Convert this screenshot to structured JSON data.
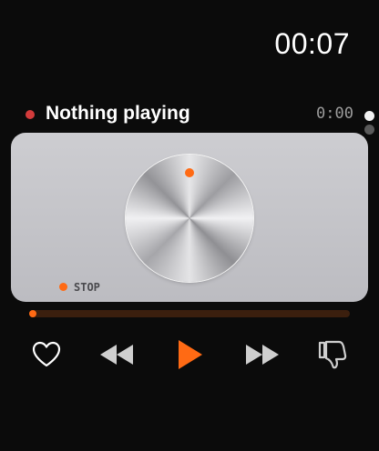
{
  "status": {
    "time": "00:07"
  },
  "now_playing": {
    "title": "Nothing playing",
    "elapsed": "0:00",
    "indicator_color": "#d23b3b"
  },
  "pager": {
    "count": 2,
    "active_index": 0
  },
  "deck": {
    "state_label": "STOP",
    "accent_color": "#ff6a14"
  },
  "progress": {
    "fraction": 0.0
  },
  "controls": {
    "items": [
      {
        "name": "like",
        "icon": "heart-icon"
      },
      {
        "name": "rewind",
        "icon": "rewind-icon"
      },
      {
        "name": "play",
        "icon": "play-icon"
      },
      {
        "name": "fast-forward",
        "icon": "fast-forward-icon"
      },
      {
        "name": "dislike",
        "icon": "thumbs-down-icon"
      }
    ]
  }
}
